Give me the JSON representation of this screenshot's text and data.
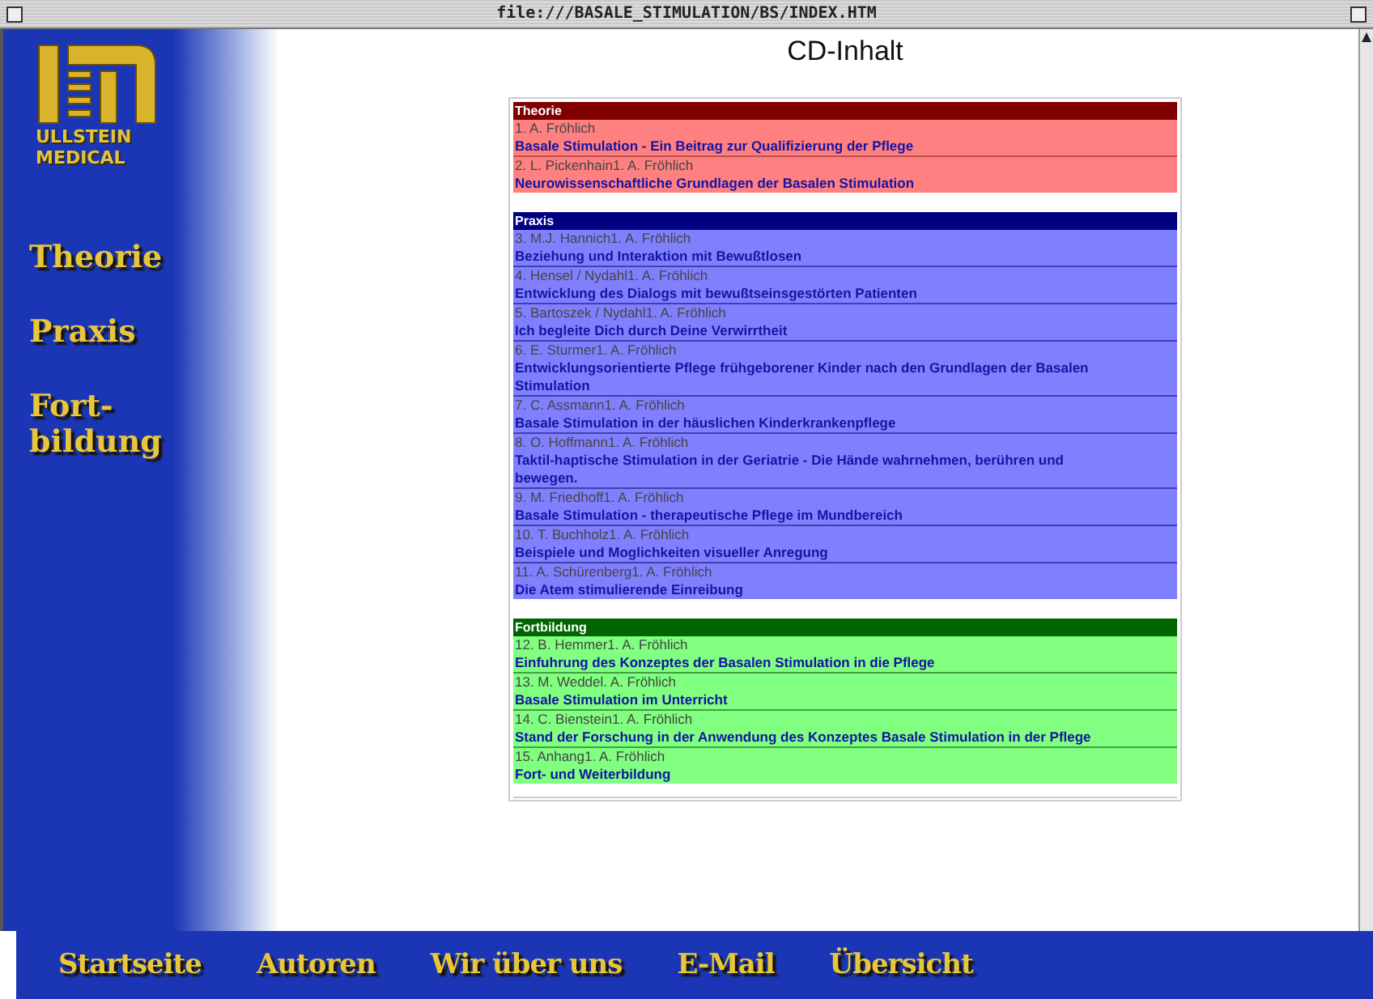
{
  "window": {
    "title": "file:///BASALE_STIMULATION/BS/INDEX.HTM"
  },
  "sidebar": {
    "logo_lines": [
      "ULLSTEIN",
      "MEDICAL"
    ],
    "items": [
      "Theorie",
      "Praxis",
      "Fort-\nbildung"
    ]
  },
  "page_title": "CD-Inhalt",
  "sections": [
    {
      "kind": "theory",
      "title": "Theorie",
      "entries": [
        {
          "author": "1. A. Fröhlich",
          "title": "Basale Stimulation - Ein Beitrag zur Qualifizierung der Pflege"
        },
        {
          "author": "2. L. Pickenhain1. A. Fröhlich",
          "title": "Neurowissenschaftliche Grundlagen der Basalen Stimulation"
        }
      ]
    },
    {
      "kind": "practice",
      "title": "Praxis",
      "entries": [
        {
          "author": "3. M.J. Hannich1. A. Fröhlich",
          "title": "Beziehung und Interaktion mit Bewußtlosen"
        },
        {
          "author": "4. Hensel / Nydahl1. A. Fröhlich",
          "title": "Entwicklung des Dialogs mit bewußtseinsgestörten Patienten"
        },
        {
          "author": "5. Bartoszek / Nydahl1. A. Fröhlich",
          "title": "Ich begleite Dich durch Deine Verwirrtheit"
        },
        {
          "author": "6. E. Sturmer1. A. Fröhlich",
          "title": "Entwicklungsorientierte Pflege frühgeborener Kinder nach den Grundlagen der Basalen Stimulation"
        },
        {
          "author": "7. C. Assmann1. A. Fröhlich",
          "title": "Basale Stimulation in der häuslichen Kinderkrankenpflege"
        },
        {
          "author": "8. O. Hoffmann1. A. Fröhlich",
          "title": "Taktil-haptische Stimulation in der Geriatrie - Die Hände wahrnehmen, berühren und bewegen."
        },
        {
          "author": "9. M. Friedhoff1. A. Fröhlich",
          "title": "Basale Stimulation - therapeutische Pflege im Mundbereich"
        },
        {
          "author": "10. T. Buchholz1. A. Fröhlich",
          "title": "Beispiele und Moglichkeiten visueller Anregung"
        },
        {
          "author": "11. A. Schürenberg1. A. Fröhlich",
          "title": "Die Atem stimulierende Einreibung"
        }
      ]
    },
    {
      "kind": "training",
      "title": "Fortbildung",
      "entries": [
        {
          "author": "12. B. Hemmer1. A. Fröhlich",
          "title": "Einfuhrung des Konzeptes der Basalen Stimulation in die Pflege"
        },
        {
          "author": "13. M. Weddel. A. Fröhlich",
          "title": "Basale Stimulation im Unterricht"
        },
        {
          "author": "14. C. Bienstein1. A. Fröhlich",
          "title": "Stand der Forschung in der Anwendung des Konzeptes Basale Stimulation in der Pflege"
        },
        {
          "author": "15. Anhang1. A. Fröhlich",
          "title": "Fort- und Weiterbildung"
        }
      ]
    }
  ],
  "bottom_nav": [
    "Startseite",
    "Autoren",
    "Wir über uns",
    "E-Mail",
    "Übersicht"
  ]
}
